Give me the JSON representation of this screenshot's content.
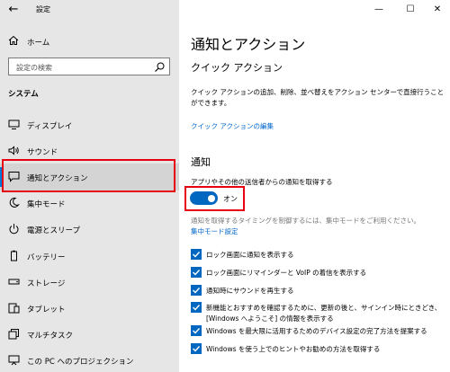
{
  "window": {
    "title": "設定"
  },
  "sidebar": {
    "home_label": "ホーム",
    "search_placeholder": "設定の検索",
    "section_label": "システム",
    "items": [
      {
        "label": "ディスプレイ",
        "icon": "display-icon"
      },
      {
        "label": "サウンド",
        "icon": "speaker-icon"
      },
      {
        "label": "通知とアクション",
        "icon": "notification-icon",
        "selected": true
      },
      {
        "label": "集中モード",
        "icon": "moon-icon"
      },
      {
        "label": "電源とスリープ",
        "icon": "power-icon"
      },
      {
        "label": "バッテリー",
        "icon": "battery-icon"
      },
      {
        "label": "ストレージ",
        "icon": "storage-icon"
      },
      {
        "label": "タブレット",
        "icon": "tablet-icon"
      },
      {
        "label": "マルチタスク",
        "icon": "multitask-icon"
      },
      {
        "label": "この PC へのプロジェクション",
        "icon": "projection-icon"
      }
    ]
  },
  "main": {
    "title": "通知とアクション",
    "quick_actions": {
      "heading": "クイック アクション",
      "description": "クイック アクションの追加、削除、並べ替えをアクション センターで直接行うことができます。",
      "edit_link": "クイック アクションの編集"
    },
    "notifications": {
      "heading": "通知",
      "toggle_label": "アプリやその他の送信者からの通知を取得する",
      "toggle_state": "オン",
      "toggle_on": true,
      "focus_hint": "通知を取得するタイミングを制御するには、集中モードをご利用ください。",
      "focus_link": "集中モード設定",
      "checkboxes": [
        {
          "label": "ロック画面に通知を表示する",
          "checked": true
        },
        {
          "label": "ロック画面にリマインダーと VoIP の着信を表示する",
          "checked": true
        },
        {
          "label": "通知時にサウンドを再生する",
          "checked": true
        },
        {
          "label": "新機能とおすすめを確認するために、更新の後と、サインイン時にときどき、[Windows へようこそ] の情報を表示する",
          "checked": true
        },
        {
          "label": "Windows を最大限に活用するためのデバイス設定の完了方法を提案する",
          "checked": true
        },
        {
          "label": "Windows を使う上でのヒントやお勧めの方法を取得する",
          "checked": true
        }
      ]
    }
  },
  "colors": {
    "accent": "#0067c0",
    "link": "#0066cc",
    "highlight": "#e60012",
    "sidebar_bg": "#e6e6e6"
  }
}
